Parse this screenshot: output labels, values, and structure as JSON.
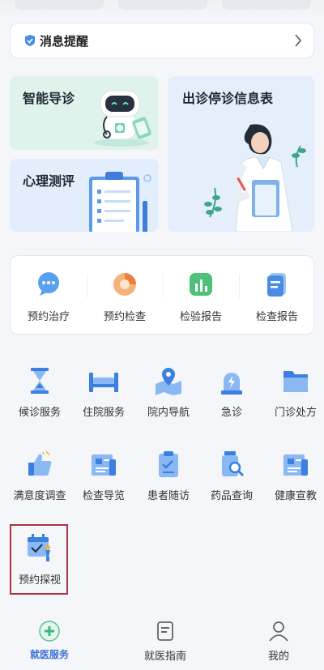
{
  "notice": {
    "label": "消息提醒",
    "icon": "shield-bell-icon"
  },
  "cards": {
    "smart_triage": "智能导诊",
    "psych_test": "心理测评",
    "clinic_schedule": "出诊停诊信息表"
  },
  "quick_actions": [
    {
      "label": "预约治疗",
      "icon": "chat-bubble-icon"
    },
    {
      "label": "预约检查",
      "icon": "pie-chart-icon"
    },
    {
      "label": "检验报告",
      "icon": "bar-report-icon"
    },
    {
      "label": "检查报告",
      "icon": "document-icon"
    }
  ],
  "services": [
    {
      "label": "候诊服务",
      "icon": "hourglass-icon"
    },
    {
      "label": "住院服务",
      "icon": "bed-icon"
    },
    {
      "label": "院内导航",
      "icon": "map-pin-icon"
    },
    {
      "label": "急诊",
      "icon": "emergency-icon"
    },
    {
      "label": "门诊处方",
      "icon": "folder-icon"
    },
    {
      "label": "满意度调查",
      "icon": "thumbs-up-icon"
    },
    {
      "label": "检查导览",
      "icon": "newspaper-icon"
    },
    {
      "label": "患者随访",
      "icon": "clipboard-icon"
    },
    {
      "label": "药品查询",
      "icon": "medicine-search-icon"
    },
    {
      "label": "健康宣教",
      "icon": "news-board-icon"
    },
    {
      "label": "预约探视",
      "icon": "visit-calendar-icon"
    }
  ],
  "tabs": [
    {
      "label": "就医服务",
      "icon": "medical-plus-icon",
      "active": true
    },
    {
      "label": "就医指南",
      "icon": "guide-book-icon",
      "active": false
    },
    {
      "label": "我的",
      "icon": "person-icon",
      "active": false
    }
  ],
  "colors": {
    "accent": "#3c6fd6",
    "icon_blue": "#4a8be8",
    "highlight_border": "#a8343f"
  }
}
